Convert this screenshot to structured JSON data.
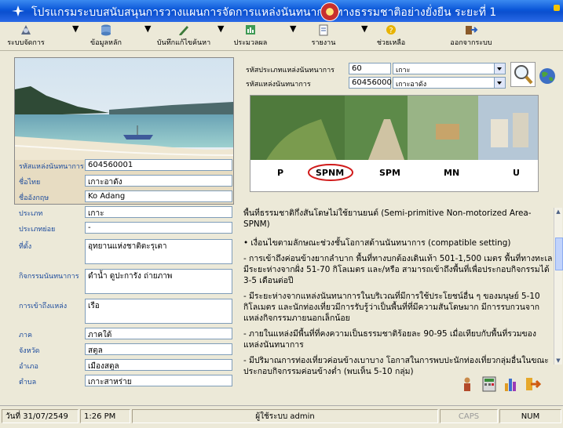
{
  "window": {
    "title": "โปรแกรมระบบสนับสนุนการวางแผนการจัดการแหล่งนันทนาการทางธรรมชาติอย่างยั่งยืน ระยะที่ 1"
  },
  "toolbar": [
    {
      "label": "ระบบจัดการ",
      "icon": "system-icon"
    },
    {
      "label": "ข้อมูลหลัก",
      "icon": "database-icon"
    },
    {
      "label": "บันทึกแก้ไขค้นหา",
      "icon": "edit-icon"
    },
    {
      "label": "ประมวลผล",
      "icon": "process-icon"
    },
    {
      "label": "รายงาน",
      "icon": "report-icon"
    },
    {
      "label": "ช่วยเหลือ",
      "icon": "help-icon"
    },
    {
      "label": "ออกจากระบบ",
      "icon": "exit-icon"
    }
  ],
  "fields": [
    {
      "label": "รหัสแหล่งนันทนาการ",
      "value": "604560001"
    },
    {
      "label": "ชื่อไทย",
      "value": "เกาะอาดัง"
    },
    {
      "label": "ชื่ออังกฤษ",
      "value": "Ko Adang"
    },
    {
      "label": "ประเภท",
      "value": "เกาะ"
    },
    {
      "label": "ประเภทย่อย",
      "value": "-"
    },
    {
      "label": "ที่ตั้ง",
      "value": "อุทยานแห่งชาติตะรุเตา"
    },
    {
      "label": "กิจกรรมนันทนาการ",
      "value": "ดำน้ำ ดูปะการัง ถ่ายภาพ"
    },
    {
      "label": "การเข้าถึงแหล่ง",
      "value": "เรือ"
    },
    {
      "label": "ภาค",
      "value": "ภาคใต้"
    },
    {
      "label": "จังหวัด",
      "value": "สตูล"
    },
    {
      "label": "อำเภอ",
      "value": "เมืองสตูล"
    },
    {
      "label": "ตำบล",
      "value": "เกาะสาหร่าย"
    }
  ],
  "filter": {
    "type_label": "รหัสประเภทแหล่งนันทนาการ",
    "type_code": "60",
    "type_name": "เกาะ",
    "site_label": "รหัสแหล่งนันทนาการ",
    "site_code": "604560001",
    "site_name": "เกาะอาดัง"
  },
  "spectrum": {
    "classes": [
      "P",
      "SPNM",
      "SPM",
      "MN",
      "U"
    ],
    "selected": "SPNM"
  },
  "description": {
    "heading": "พื้นที่ธรรมชาติกึ่งสันโดษไม่ใช้ยานยนต์ (Semi-primitive Non-motorized Area-SPNM)",
    "paragraphs": [
      "• เงื่อนไขตามลักษณะช่วงชั้นโอกาสด้านนันทนาการ (compatible setting)",
      "- การเข้าถึงค่อนข้างยากลำบาก พื้นที่ทางบกต้องเดินเท้า 501-1,500 เมตร พื้นที่ทางทะเลมีระยะห่างจากฝั่ง 51-70 กิโลเมตร และ/หรือ สามารถเข้าถึงพื้นที่เพื่อประกอบกิจกรรมได้ 3-5 เดือนต่อปี",
      "- มีระยะห่างจากแหล่งนันทนาการในบริเวณที่มีการใช้ประโยชน์อื่น ๆ ของมนุษย์ 5-10 กิโลเมตร และนักท่องเที่ยวมีการรับรู้ว่าเป็นพื้นที่ที่มีความสันโดษมาก มีการรบกวนจากแหล่งกิจกรรมภายนอกเล็กน้อย",
      "- ภายในแหล่งมีพื้นที่ที่คงความเป็นธรรมชาติร้อยละ 90-95 เมื่อเทียบกับพื้นที่รวมของแหล่งนันทนาการ",
      "- มีปริมาณการท่องเที่ยวค่อนข้างเบาบาง โอกาสในการพบปะนักท่องเที่ยวกลุ่มอื่นในขณะประกอบกิจกรรมค่อนข้างต่ำ (พบเห็น 5-10 กลุ่ม)"
    ]
  },
  "actions": [
    {
      "icon": "person-icon"
    },
    {
      "icon": "calculator-icon"
    },
    {
      "icon": "chart-icon"
    },
    {
      "icon": "exit-arrow-icon"
    }
  ],
  "status": {
    "date": "วันที่ 31/07/2549",
    "time": "1:26 PM",
    "user": "ผู้ใช้ระบบ admin",
    "caps": "CAPS",
    "num": "NUM"
  }
}
